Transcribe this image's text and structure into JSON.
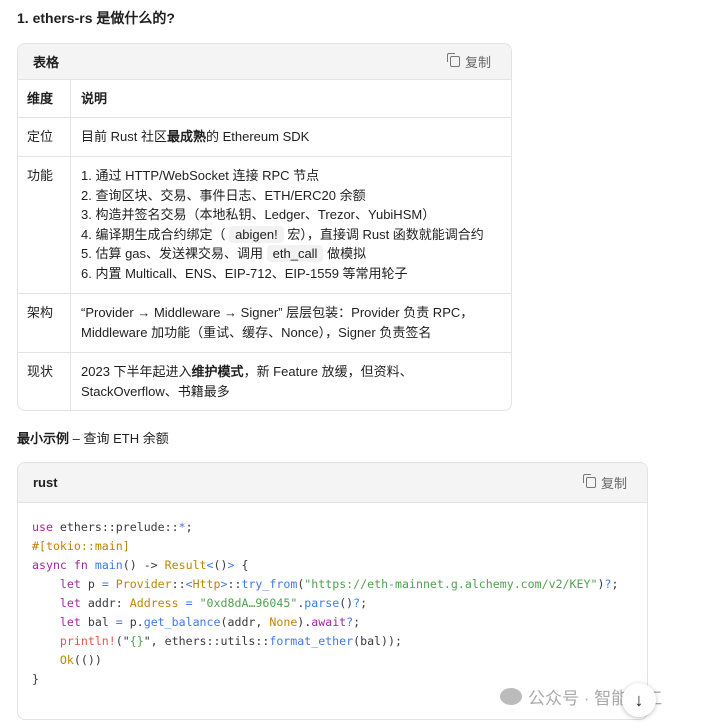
{
  "heading": "1. ethers-rs 是做什么的?",
  "table_block": {
    "title": "表格",
    "copy_label": "复制",
    "headers": [
      "维度",
      "说明"
    ],
    "rows": [
      {
        "k": "定位",
        "v": [
          [
            "目前 Rust 社区",
            ""
          ],
          [
            "最成熟",
            "b"
          ],
          [
            "的 Ethereum SDK",
            ""
          ]
        ]
      },
      {
        "k": "功能",
        "lines": [
          [
            [
              "1. 通过 HTTP/WebSocket 连接 RPC 节点",
              ""
            ]
          ],
          [
            [
              "2. 查询区块、交易、事件日志、ETH/ERC20 余额",
              ""
            ]
          ],
          [
            [
              "3. 构造并签名交易（本地私钥、Ledger、Trezor、YubiHSM）",
              ""
            ]
          ],
          [
            [
              "4. 编译期生成合约绑定（ ",
              ""
            ],
            [
              "abigen!",
              "c"
            ],
            [
              " 宏），直接调 Rust 函数就能调合约",
              ""
            ]
          ],
          [
            [
              "5. 估算 gas、发送裸交易、调用 ",
              ""
            ],
            [
              "eth_call",
              "c"
            ],
            [
              " 做模拟",
              ""
            ]
          ],
          [
            [
              "6. 内置 Multicall、ENS、EIP-712、EIP-1559 等常用轮子",
              ""
            ]
          ]
        ]
      },
      {
        "k": "架构",
        "v": [
          [
            "“Provider → Middleware → Signer” 层层包装：Provider 负责 RPC，Middleware 加功能（重试、缓存、Nonce），Signer 负责签名",
            ""
          ]
        ]
      },
      {
        "k": "现状",
        "v": [
          [
            "2023 下半年起进入",
            ""
          ],
          [
            "维护模式",
            "b"
          ],
          [
            "，新 Feature 放缓，但资料、StackOverflow、书籍最多",
            ""
          ]
        ]
      }
    ]
  },
  "section": {
    "bold": "最小示例",
    "rest": " – 查询 ETH 余额"
  },
  "code_block": {
    "lang": "rust",
    "copy_label": "复制",
    "lines": [
      [
        [
          "use",
          "kw"
        ],
        [
          " ethers::prelude::",
          ""
        ],
        [
          "*",
          "op"
        ],
        [
          ";",
          ""
        ]
      ],
      [
        [
          "#[tokio::main]",
          "ty"
        ]
      ],
      [
        [
          "async",
          "kw"
        ],
        [
          " ",
          ""
        ],
        [
          "fn",
          "kw"
        ],
        [
          " ",
          ""
        ],
        [
          "main",
          "fn"
        ],
        [
          "() -> ",
          ""
        ],
        [
          "Result",
          "ty"
        ],
        [
          "<",
          "op"
        ],
        [
          "()",
          ""
        ],
        [
          ">",
          "op"
        ],
        [
          " {",
          ""
        ]
      ],
      [
        [
          "    ",
          ""
        ],
        [
          "let",
          "kw"
        ],
        [
          " p ",
          ""
        ],
        [
          "=",
          "op"
        ],
        [
          " ",
          ""
        ],
        [
          "Provider",
          "ty"
        ],
        [
          "::",
          ""
        ],
        [
          "<",
          "op"
        ],
        [
          "Http",
          "ty"
        ],
        [
          ">",
          "op"
        ],
        [
          "::",
          ""
        ],
        [
          "try_from",
          "fn"
        ],
        [
          "(",
          ""
        ],
        [
          "\"https://eth-mainnet.g.alchemy.com/v2/KEY\"",
          "str"
        ],
        [
          ")",
          ""
        ],
        [
          "?",
          "op"
        ],
        [
          ";",
          ""
        ]
      ],
      [
        [
          "    ",
          ""
        ],
        [
          "let",
          "kw"
        ],
        [
          " addr: ",
          ""
        ],
        [
          "Address",
          "ty"
        ],
        [
          " ",
          ""
        ],
        [
          "=",
          "op"
        ],
        [
          " ",
          ""
        ],
        [
          "\"0xd8dA…96045\"",
          "str"
        ],
        [
          ".",
          ""
        ],
        [
          "parse",
          "fn"
        ],
        [
          "()",
          ""
        ],
        [
          "?",
          "op"
        ],
        [
          ";",
          ""
        ]
      ],
      [
        [
          "    ",
          ""
        ],
        [
          "let",
          "kw"
        ],
        [
          " bal ",
          ""
        ],
        [
          "=",
          "op"
        ],
        [
          " p.",
          ""
        ],
        [
          "get_balance",
          "fn"
        ],
        [
          "(addr, ",
          ""
        ],
        [
          "None",
          "ty"
        ],
        [
          ").",
          ""
        ],
        [
          "await",
          "kw"
        ],
        [
          "?",
          "op"
        ],
        [
          ";",
          ""
        ]
      ],
      [
        [
          "    ",
          ""
        ],
        [
          "println!",
          "mac"
        ],
        [
          "(\"",
          ""
        ],
        [
          "{}",
          "str"
        ],
        [
          "\", ethers::utils::",
          ""
        ],
        [
          "format_ether",
          "fn"
        ],
        [
          "(bal));",
          ""
        ]
      ],
      [
        [
          "    ",
          ""
        ],
        [
          "Ok",
          "ty"
        ],
        [
          "(())",
          ""
        ]
      ],
      [
        [
          "}",
          ""
        ]
      ]
    ]
  },
  "watermark": "公众号 · 智能金工"
}
